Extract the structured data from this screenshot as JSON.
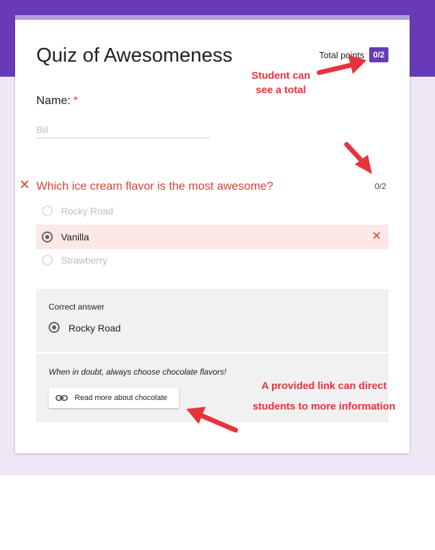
{
  "quiz": {
    "title": "Quiz of Awesomeness",
    "total_points_label": "Total points",
    "total_points_value": "0/2"
  },
  "name_field": {
    "label": "Name:",
    "required_marker": "*",
    "value": "Bill"
  },
  "question": {
    "wrong_marker": "✕",
    "text": "Which ice cream flavor is the most awesome?",
    "score": "0/2",
    "options": [
      {
        "label": "Rocky Road",
        "selected": false
      },
      {
        "label": "Vanilla",
        "selected": true,
        "marked_wrong": true
      },
      {
        "label": "Strawberry",
        "selected": false
      }
    ],
    "wrong_option_marker": "✕"
  },
  "correct_answer": {
    "heading": "Correct answer",
    "value": "Rocky Road"
  },
  "feedback": {
    "text": "When in doubt, always choose chocolate flavors!",
    "link_label": "Read more about chocolate",
    "link_icon": "link-icon"
  },
  "annotations": {
    "total_line1": "Student can",
    "total_line2": "see a total",
    "link_line1": "A provided link can direct",
    "link_line2": "students to more information"
  },
  "colors": {
    "header_purple": "#673ab7",
    "background_lavender": "#ede7f6",
    "error_red": "#db4437",
    "annotation_red": "#e8323c",
    "wrong_option_bg": "#fce8e6"
  }
}
